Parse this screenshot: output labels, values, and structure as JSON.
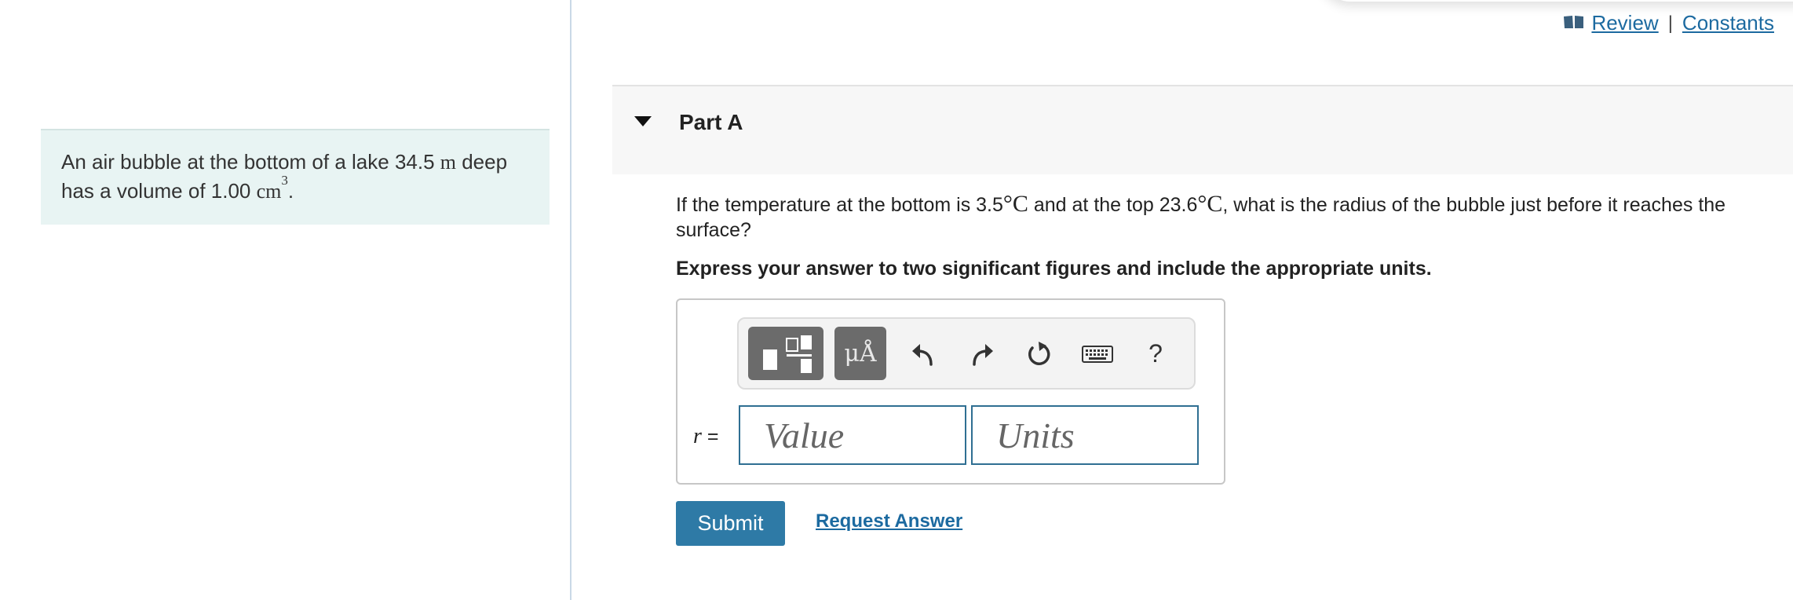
{
  "problem": {
    "text_before": "An air bubble at the bottom of a lake 34.5 ",
    "depth_unit": "m",
    "text_middle": " deep has a volume of 1.00 ",
    "volume_unit": "cm",
    "volume_exp": "3",
    "text_end": "."
  },
  "links": {
    "review": "Review",
    "separator": "|",
    "constants": "Constants"
  },
  "part": {
    "title": "Part A"
  },
  "question": {
    "t1": "If the temperature at the bottom is 3.5",
    "deg1": "°C",
    "t2": " and at the top 23.6",
    "deg2": "°C",
    "t3": ", what is the radius of the bubble just before it reaches the surface?"
  },
  "instruction": "Express your answer to two significant figures and include the appropriate units.",
  "toolbar": {
    "symbols_label": "μÅ",
    "help_label": "?"
  },
  "answer": {
    "variable": "r",
    "equals": " =",
    "value_placeholder": "Value",
    "units_placeholder": "Units"
  },
  "actions": {
    "submit": "Submit",
    "request_answer": "Request Answer"
  },
  "colors": {
    "accent": "#2e7aa6",
    "link": "#1c6aa0",
    "problem_bg": "#e8f4f3"
  }
}
